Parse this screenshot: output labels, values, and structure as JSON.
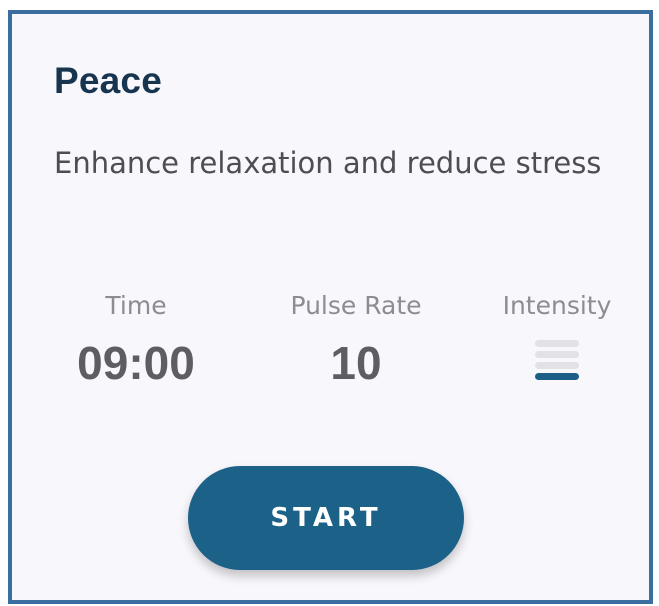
{
  "card": {
    "title": "Peace",
    "description": "Enhance relaxation and reduce stress"
  },
  "stats": {
    "time": {
      "label": "Time",
      "value": "09:00"
    },
    "pulse_rate": {
      "label": "Pulse Rate",
      "value": "10"
    },
    "intensity": {
      "label": "Intensity",
      "level": 1,
      "max_level": 4
    }
  },
  "actions": {
    "start_label": "START"
  },
  "colors": {
    "frame_border": "#3a6e9e",
    "title": "#17354f",
    "accent": "#1b6188"
  }
}
